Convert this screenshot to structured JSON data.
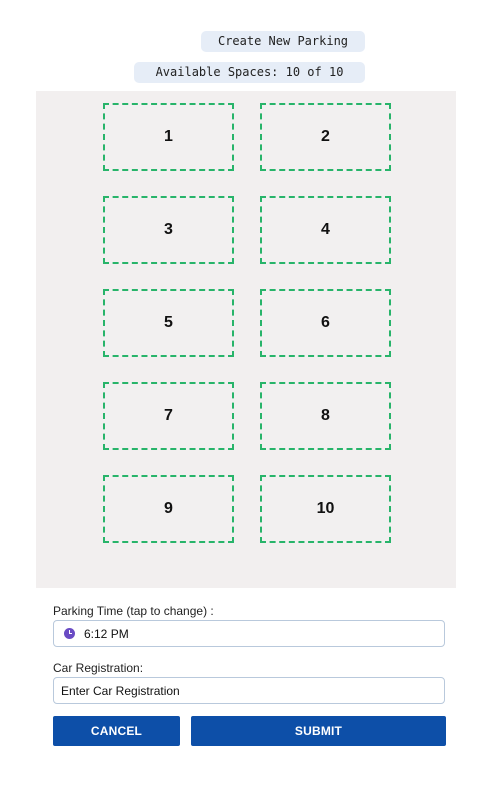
{
  "header": {
    "title": "Create New Parking",
    "availability": "Available Spaces: 10 of 10"
  },
  "lot": {
    "spaces": [
      {
        "label": "1"
      },
      {
        "label": "2"
      },
      {
        "label": "3"
      },
      {
        "label": "4"
      },
      {
        "label": "5"
      },
      {
        "label": "6"
      },
      {
        "label": "7"
      },
      {
        "label": "8"
      },
      {
        "label": "9"
      },
      {
        "label": "10"
      }
    ]
  },
  "form": {
    "time_label": "Parking Time (tap to change) :",
    "time_value": "6:12 PM",
    "time_icon": "clock-icon",
    "registration_label": "Car Registration:",
    "registration_placeholder": "Enter Car Registration",
    "registration_value": ""
  },
  "actions": {
    "cancel_label": "CANCEL",
    "submit_label": "SUBMIT"
  },
  "colors": {
    "primary": "#0d4fa8",
    "space_border": "#28b46a",
    "lot_background": "#f2efef",
    "pill_background": "#e6edf7",
    "clock_icon": "#6a4bc4"
  }
}
